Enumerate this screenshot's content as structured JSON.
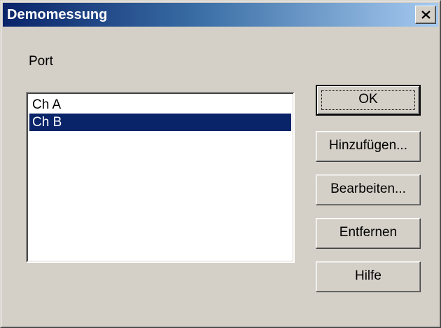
{
  "window": {
    "title": "Demomessung",
    "close_icon": "close-icon"
  },
  "port": {
    "label": "Port",
    "items": [
      {
        "label": "Ch A",
        "selected": false
      },
      {
        "label": "Ch B",
        "selected": true
      }
    ]
  },
  "buttons": {
    "ok": "OK",
    "add": "Hinzufügen...",
    "edit": "Bearbeiten...",
    "remove": "Entfernen",
    "help": "Hilfe"
  },
  "colors": {
    "title_gradient_start": "#0a246a",
    "title_gradient_end": "#a6caf0",
    "dialog_face": "#d4d0c8",
    "selection": "#0a246a"
  }
}
